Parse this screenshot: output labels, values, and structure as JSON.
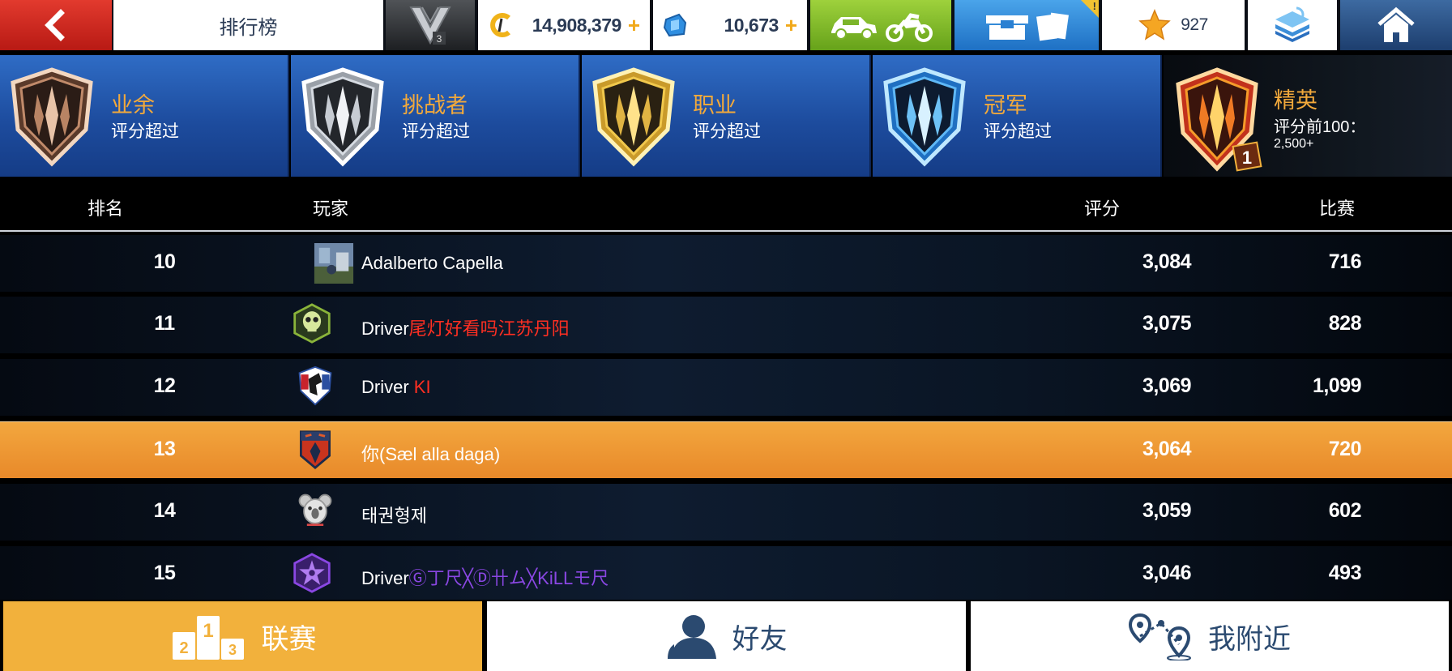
{
  "topbar": {
    "title": "排行榜",
    "cash": "14,908,379",
    "tokens": "10,673",
    "stars": "927",
    "plus": "+",
    "pack_alert": "!",
    "rank_badge": "3",
    "icons": [
      "back-arrow-icon",
      "vip-rank-icon",
      "credits-coin-icon",
      "token-icon",
      "car-motorbike-icon",
      "card-packs-icon",
      "star-icon",
      "layers-icon",
      "home-icon"
    ]
  },
  "leagues": [
    {
      "name": "业余",
      "subtitle": "评分超过",
      "color": "bronze"
    },
    {
      "name": "挑战者",
      "subtitle": "评分超过",
      "color": "silver"
    },
    {
      "name": "职业",
      "subtitle": "评分超过",
      "color": "gold"
    },
    {
      "name": "冠军",
      "subtitle": "评分超过",
      "color": "blue"
    },
    {
      "name": "精英",
      "subtitle": "评分前100：",
      "value": "2,500+",
      "badge": "1",
      "color": "red-gold"
    }
  ],
  "columns": {
    "rank": "排名",
    "player": "玩家",
    "score": "评分",
    "races": "比赛"
  },
  "rows": [
    {
      "rank": "10",
      "name": "Adalberto Capella",
      "name_prefix": "",
      "name_suffix": "",
      "score": "3,084",
      "races": "716"
    },
    {
      "rank": "11",
      "name_prefix": "Driver",
      "name_suffix": "尾灯好看吗江苏丹阳",
      "score": "3,075",
      "races": "828"
    },
    {
      "rank": "12",
      "name_prefix": "Driver ",
      "name_suffix": "KI",
      "score": "3,069",
      "races": "1,099"
    },
    {
      "rank": "13",
      "name": "你(Sæl alla daga)",
      "score": "3,064",
      "races": "720"
    },
    {
      "rank": "14",
      "name": "태권형제",
      "score": "3,059",
      "races": "602"
    },
    {
      "rank": "15",
      "name_prefix": "Driver",
      "name_suffix": "Ⓖ丁尺╳Ⓓ卄ム╳KiLLモ尺",
      "score": "3,046",
      "races": "493"
    }
  ],
  "tabs": {
    "league": "联赛",
    "friends": "好友",
    "nearby": "我附近",
    "podium": [
      "2",
      "1",
      "3"
    ]
  },
  "colors": {
    "accent_orange": "#f2b13c",
    "highlight_row": "#eb942f",
    "league_blue": "#1d4c9e",
    "name_red": "#ff2f22",
    "name_purple": "#8a47e3"
  }
}
